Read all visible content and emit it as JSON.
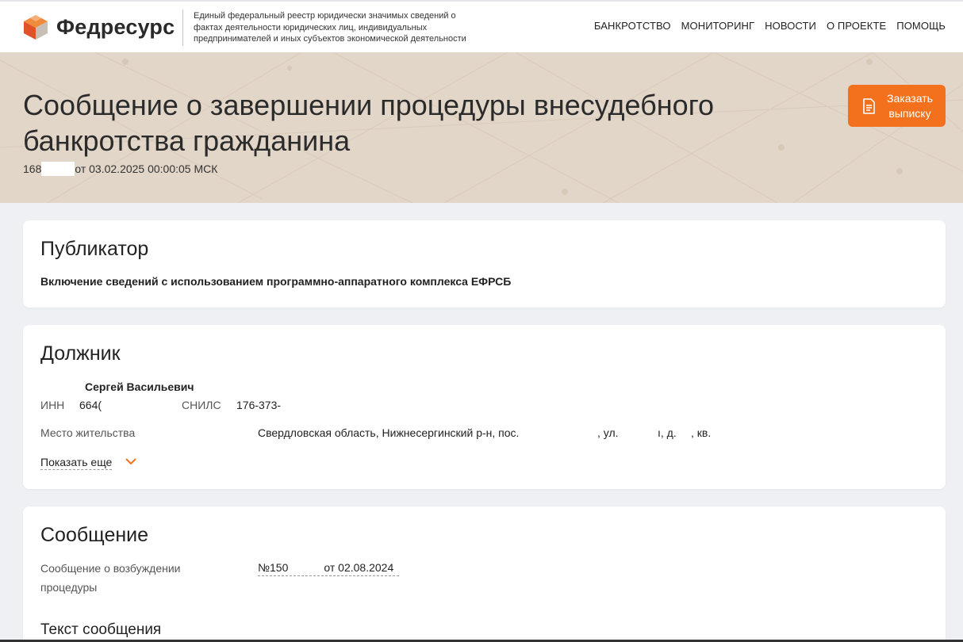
{
  "header": {
    "brand": "Федресурс",
    "tagline": "Единый федеральный реестр юридически значимых сведений о фактах деятельности юридических лиц, индивидуальных предпринимателей и иных субъектов экономической деятельности",
    "nav": [
      "БАНКРОТСТВО",
      "МОНИТОРИНГ",
      "НОВОСТИ",
      "О ПРОЕКТЕ",
      "ПОМОЩЬ"
    ]
  },
  "hero": {
    "title": "Сообщение о завершении процедуры внесудебного банкротства гражданина",
    "number_prefix": "168",
    "date_text": "от 03.02.2025 00:00:05 МСК",
    "order_button": "Заказать выписку"
  },
  "publisher": {
    "heading": "Публикатор",
    "text": "Включение сведений с использованием программно-аппаратного комплекса ЕФРСБ"
  },
  "debtor": {
    "heading": "Должник",
    "name": "Сергей Васильевич",
    "inn_label": "ИНН",
    "inn_value": "664(",
    "snils_label": "СНИЛС",
    "snils_value": "176-373-",
    "residence_label": "Место жительства",
    "residence_part1": "Свердловская область, Нижнесергинский р-н, пос.",
    "residence_ul": ", ул.",
    "residence_d": "ı, д.",
    "residence_kv": ", кв.",
    "show_more": "Показать еще"
  },
  "message": {
    "heading": "Сообщение",
    "initiation_label": "Сообщение о возбуждении процедуры",
    "initiation_number": "№150",
    "initiation_date": "от 02.08.2024",
    "text_heading": "Текст сообщения"
  },
  "colors": {
    "accent": "#f3711c",
    "hero_bg": "#e2d6c8",
    "page_bg": "#eef0f3"
  }
}
